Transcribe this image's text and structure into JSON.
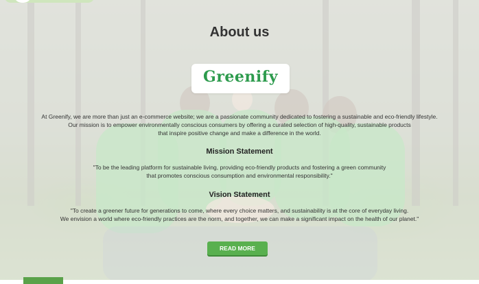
{
  "page": {
    "title": "About us"
  },
  "logo": {
    "text": "Greenify",
    "brand_color": "#2d9b4d"
  },
  "intro": {
    "line1": "At Greenify, we are more than just an e-commerce website; we are a passionate community dedicated to fostering a sustainable and eco-friendly lifestyle.",
    "line2": "Our mission is to empower environmentally conscious consumers by offering a curated selection of high-quality, sustainable products",
    "line3": "that inspire positive change and make a difference in the world."
  },
  "mission": {
    "heading": "Mission Statement",
    "line1": "\"To be the leading platform for sustainable living, providing eco-friendly products and fostering a green community",
    "line2": "that promotes conscious consumption and environmental responsibility.\""
  },
  "vision": {
    "heading": "Vision Statement",
    "line1": "\"To create a greener future for generations to come, where every choice matters, and sustainability is at the core of everyday living.",
    "line2": "We envision a world where eco-friendly practices are the norm, and together, we can make a significant impact on the health of our planet.\""
  },
  "cta": {
    "label": "READ MORE",
    "color": "#59b04f"
  }
}
